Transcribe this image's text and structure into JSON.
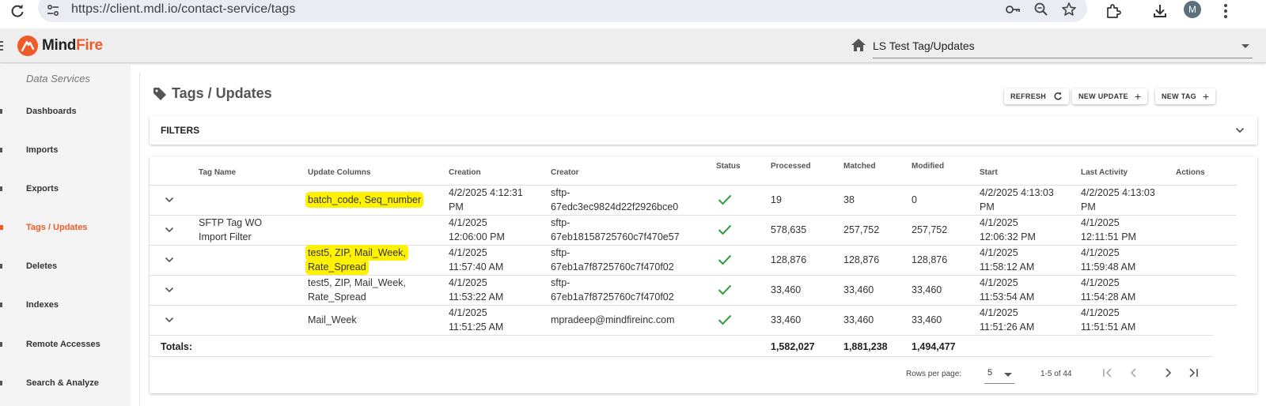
{
  "browser": {
    "url": "https://client.mdl.io/contact-service/tags",
    "profile_initial": "M"
  },
  "header": {
    "logo_text_part1": "Mind",
    "logo_text_part2": "Fire",
    "account_selector": "LS Test Tag/Updates"
  },
  "sidebar": {
    "section_title": "Data Services",
    "items": [
      {
        "label": "Dashboards"
      },
      {
        "label": "Imports"
      },
      {
        "label": "Exports"
      },
      {
        "label": "Tags / Updates",
        "active": true
      },
      {
        "label": "Deletes"
      },
      {
        "label": "Indexes"
      },
      {
        "label": "Remote Accesses"
      },
      {
        "label": "Search & Analyze"
      }
    ]
  },
  "main": {
    "title": "Tags / Updates",
    "buttons": {
      "refresh": "REFRESH",
      "new_update": "NEW UPDATE",
      "new_tag": "NEW TAG"
    },
    "filters_label": "FILTERS"
  },
  "table": {
    "headers": {
      "tag_name": "Tag Name",
      "update_columns": "Update Columns",
      "creation": "Creation",
      "creator": "Creator",
      "status": "Status",
      "processed": "Processed",
      "matched": "Matched",
      "modified": "Modified",
      "start": "Start",
      "last_activity": "Last Activity",
      "actions": "Actions"
    },
    "rows": [
      {
        "tag_name": [
          "",
          ""
        ],
        "update_columns": [
          "batch_code, Seq_number",
          ""
        ],
        "creation": [
          "4/2/2025 4:12:31",
          "PM"
        ],
        "creator": [
          "sftp-",
          "67edc3ec9824d22f2926bce0"
        ],
        "processed": "19",
        "matched": "38",
        "modified": "0",
        "start": [
          "4/2/2025 4:13:03",
          "PM"
        ],
        "last_activity": [
          "4/2/2025 4:13:03",
          "PM"
        ]
      },
      {
        "tag_name": [
          "SFTP Tag WO",
          "Import Filter"
        ],
        "update_columns": [
          "",
          ""
        ],
        "creation": [
          "4/1/2025",
          "12:06:00 PM"
        ],
        "creator": [
          "sftp-",
          "67eb18158725760c7f470e57"
        ],
        "processed": "578,635",
        "matched": "257,752",
        "modified": "257,752",
        "start": [
          "4/1/2025",
          "12:06:32 PM"
        ],
        "last_activity": [
          "4/1/2025",
          "12:11:51 PM"
        ]
      },
      {
        "tag_name": [
          "",
          ""
        ],
        "update_columns": [
          "test5, ZIP, Mail_Week,",
          "Rate_Spread"
        ],
        "creation": [
          "4/1/2025",
          "11:57:40 AM"
        ],
        "creator": [
          "sftp-",
          "67eb1a7f8725760c7f470f02"
        ],
        "processed": "128,876",
        "matched": "128,876",
        "modified": "128,876",
        "start": [
          "4/1/2025",
          "11:58:12 AM"
        ],
        "last_activity": [
          "4/1/2025",
          "11:59:48 AM"
        ]
      },
      {
        "tag_name": [
          "",
          ""
        ],
        "update_columns": [
          "test5, ZIP, Mail_Week,",
          "Rate_Spread"
        ],
        "creation": [
          "4/1/2025",
          "11:53:22 AM"
        ],
        "creator": [
          "sftp-",
          "67eb1a7f8725760c7f470f02"
        ],
        "processed": "33,460",
        "matched": "33,460",
        "modified": "33,460",
        "start": [
          "4/1/2025",
          "11:53:54 AM"
        ],
        "last_activity": [
          "4/1/2025",
          "11:54:28 AM"
        ]
      },
      {
        "tag_name": [
          "",
          ""
        ],
        "update_columns": [
          "Mail_Week",
          ""
        ],
        "creation": [
          "4/1/2025",
          "11:51:25 AM"
        ],
        "creator": [
          "mpradeep@mindfireinc.com",
          ""
        ],
        "processed": "33,460",
        "matched": "33,460",
        "modified": "33,460",
        "start": [
          "4/1/2025",
          "11:51:26 AM"
        ],
        "last_activity": [
          "4/1/2025",
          "11:51:51 AM"
        ]
      }
    ],
    "totals": {
      "label": "Totals:",
      "processed": "1,582,027",
      "matched": "1,881,238",
      "modified": "1,494,477"
    },
    "pagination": {
      "rows_per_page_label": "Rows per page:",
      "rows_per_page": "5",
      "range": "1-5 of 44"
    }
  },
  "colors": {
    "accent": "#f05a28",
    "highlight": "#fff200",
    "status_ok": "#2e9e3e"
  }
}
